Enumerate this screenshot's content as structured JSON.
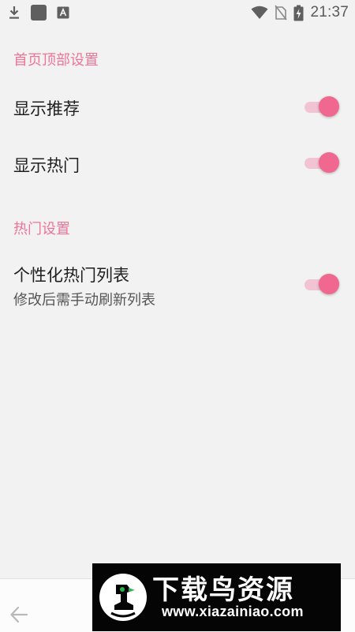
{
  "status_bar": {
    "time": "21:37",
    "left_icons": [
      "download-icon",
      "app-square-icon",
      "keyboard-a-icon"
    ],
    "right_icons": [
      "wifi-icon",
      "no-sim-icon",
      "battery-charging-icon"
    ]
  },
  "settings": {
    "categories": [
      {
        "title": "首页顶部设置",
        "items": [
          {
            "title": "显示推荐",
            "enabled": true
          },
          {
            "title": "显示热门",
            "enabled": true
          }
        ]
      },
      {
        "title": "热门设置",
        "items": [
          {
            "title": "个性化热门列表",
            "summary": "修改后需手动刷新列表",
            "enabled": true
          }
        ]
      }
    ]
  },
  "navigation": {
    "back_icon": "arrow-left-icon"
  },
  "watermark": {
    "title": "下载鸟资源",
    "url": "www.xiazainiao.com"
  },
  "colors": {
    "accent": "#ef7497",
    "switch_thumb": "#f06790",
    "switch_track": "#f2c3d3",
    "background": "#f2f2f2"
  }
}
